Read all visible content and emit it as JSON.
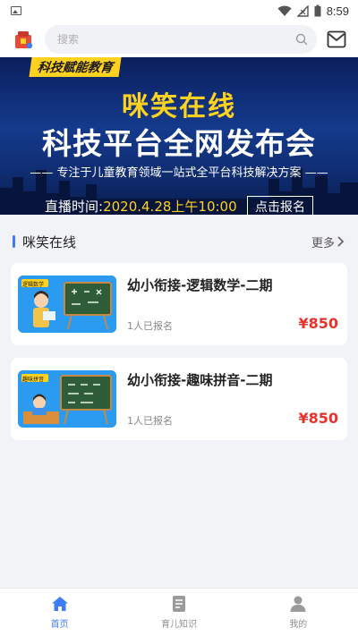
{
  "status": {
    "time": "8:59"
  },
  "header": {
    "search_placeholder": "搜索"
  },
  "banner": {
    "tag": "科技赋能教育",
    "title_line1": "咪笑在线",
    "title_line2": "科技平台全网发布会",
    "subtitle": "—— 专注于儿童教育领域一站式全平台科技解决方案 ——",
    "live_label": "直播时间:",
    "live_value": "2020.4.28上午10:00",
    "register_label": "点击报名"
  },
  "section": {
    "title": "咪笑在线",
    "more_label": "更多"
  },
  "courses": [
    {
      "title": "幼小衔接-逻辑数学-二期",
      "count": "1人已报名",
      "price": "¥850",
      "thumb_badge": "逻辑数学"
    },
    {
      "title": "幼小衔接-趣味拼音-二期",
      "count": "1人已报名",
      "price": "¥850",
      "thumb_badge": "趣味拼音"
    }
  ],
  "tabbar": [
    {
      "label": "首页",
      "icon": "home-icon",
      "active": true
    },
    {
      "label": "育儿知识",
      "icon": "document-icon",
      "active": false
    },
    {
      "label": "我的",
      "icon": "user-icon",
      "active": false
    }
  ],
  "colors": {
    "accent": "#3d7ef5",
    "price": "#e8332f",
    "banner_yellow": "#ffd21f"
  }
}
